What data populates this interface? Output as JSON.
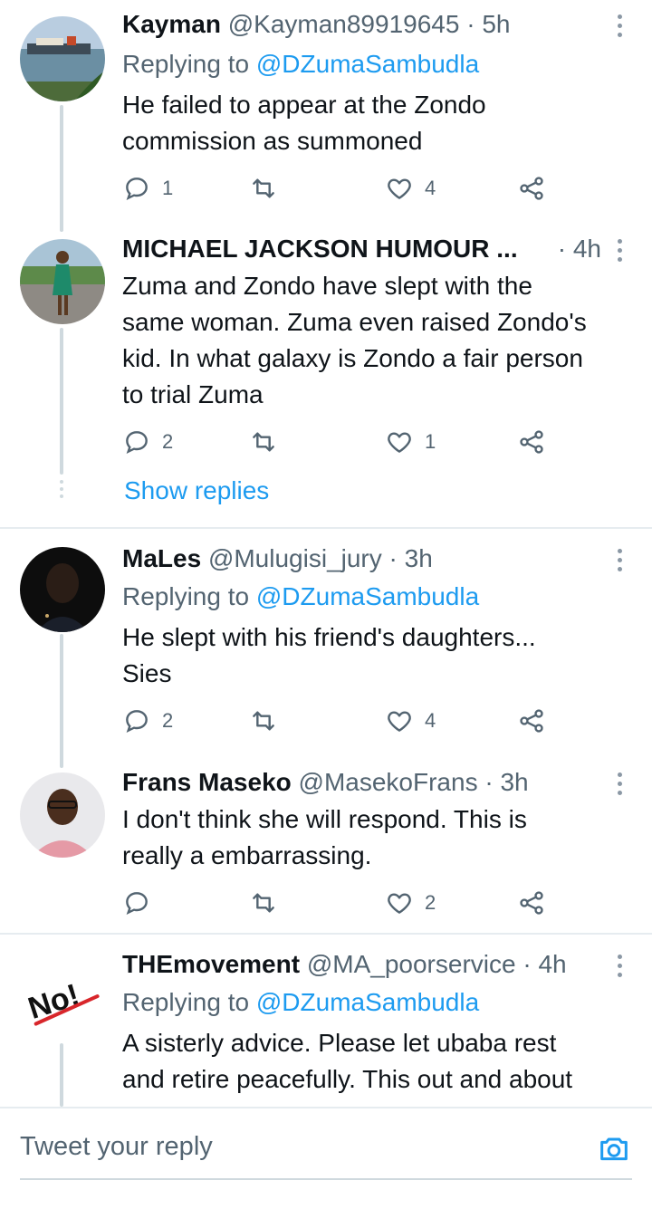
{
  "colors": {
    "accent": "#1d9bf0",
    "secondary_text": "#536471",
    "primary_text": "#0f1419",
    "divider": "#e6ecf0"
  },
  "tweets": [
    {
      "name": "Kayman",
      "handle": "@Kayman89919645",
      "dot": "·",
      "time": "5h",
      "replying_prefix": "Replying to",
      "replying_to": "@DZumaSambudla",
      "text_lines": [
        "He failed to appear at the Zondo",
        "commission as summoned"
      ],
      "reply_count": "1",
      "like_count": "4",
      "avatar": "ship-on-water-photo"
    },
    {
      "name": "MICHAEL JACKSON HUMOUR ...",
      "dot": "·",
      "time": "4h",
      "text_lines": [
        "Zuma and Zondo have slept with the",
        "same woman. Zuma even raised Zondo's",
        "kid. In what galaxy is Zondo a fair person",
        "to trial Zuma"
      ],
      "reply_count": "2",
      "like_count": "1",
      "show_replies": "Show replies",
      "avatar": "woman-in-green-dress-photo"
    },
    {
      "name": "MaLes",
      "handle": "@Mulugisi_jury",
      "dot": "·",
      "time": "3h",
      "replying_prefix": "Replying to",
      "replying_to": "@DZumaSambudla",
      "text_lines": [
        "He slept with his friend's daughters...",
        "Sies"
      ],
      "reply_count": "2",
      "like_count": "4",
      "avatar": "dark-portrait-photo"
    },
    {
      "name": "Frans Maseko",
      "handle": "@MasekoFrans",
      "dot": "·",
      "time": "3h",
      "text_lines": [
        "I don't think she will respond. This is",
        "really a embarrassing."
      ],
      "reply_count": "",
      "like_count": "2",
      "avatar": "man-with-glasses-photo"
    },
    {
      "name": "THEmovement",
      "handle": "@MA_poorservice",
      "dot": "·",
      "time": "4h",
      "replying_prefix": "Replying to",
      "replying_to": "@DZumaSambudla",
      "text_lines": [
        "A sisterly advice. Please let ubaba rest",
        "and retire peacefully. This out and about"
      ],
      "avatar": "no-sign-logo",
      "avatar_text": "No!"
    }
  ],
  "compose": {
    "placeholder": "Tweet your reply",
    "camera_icon": "camera-icon"
  }
}
